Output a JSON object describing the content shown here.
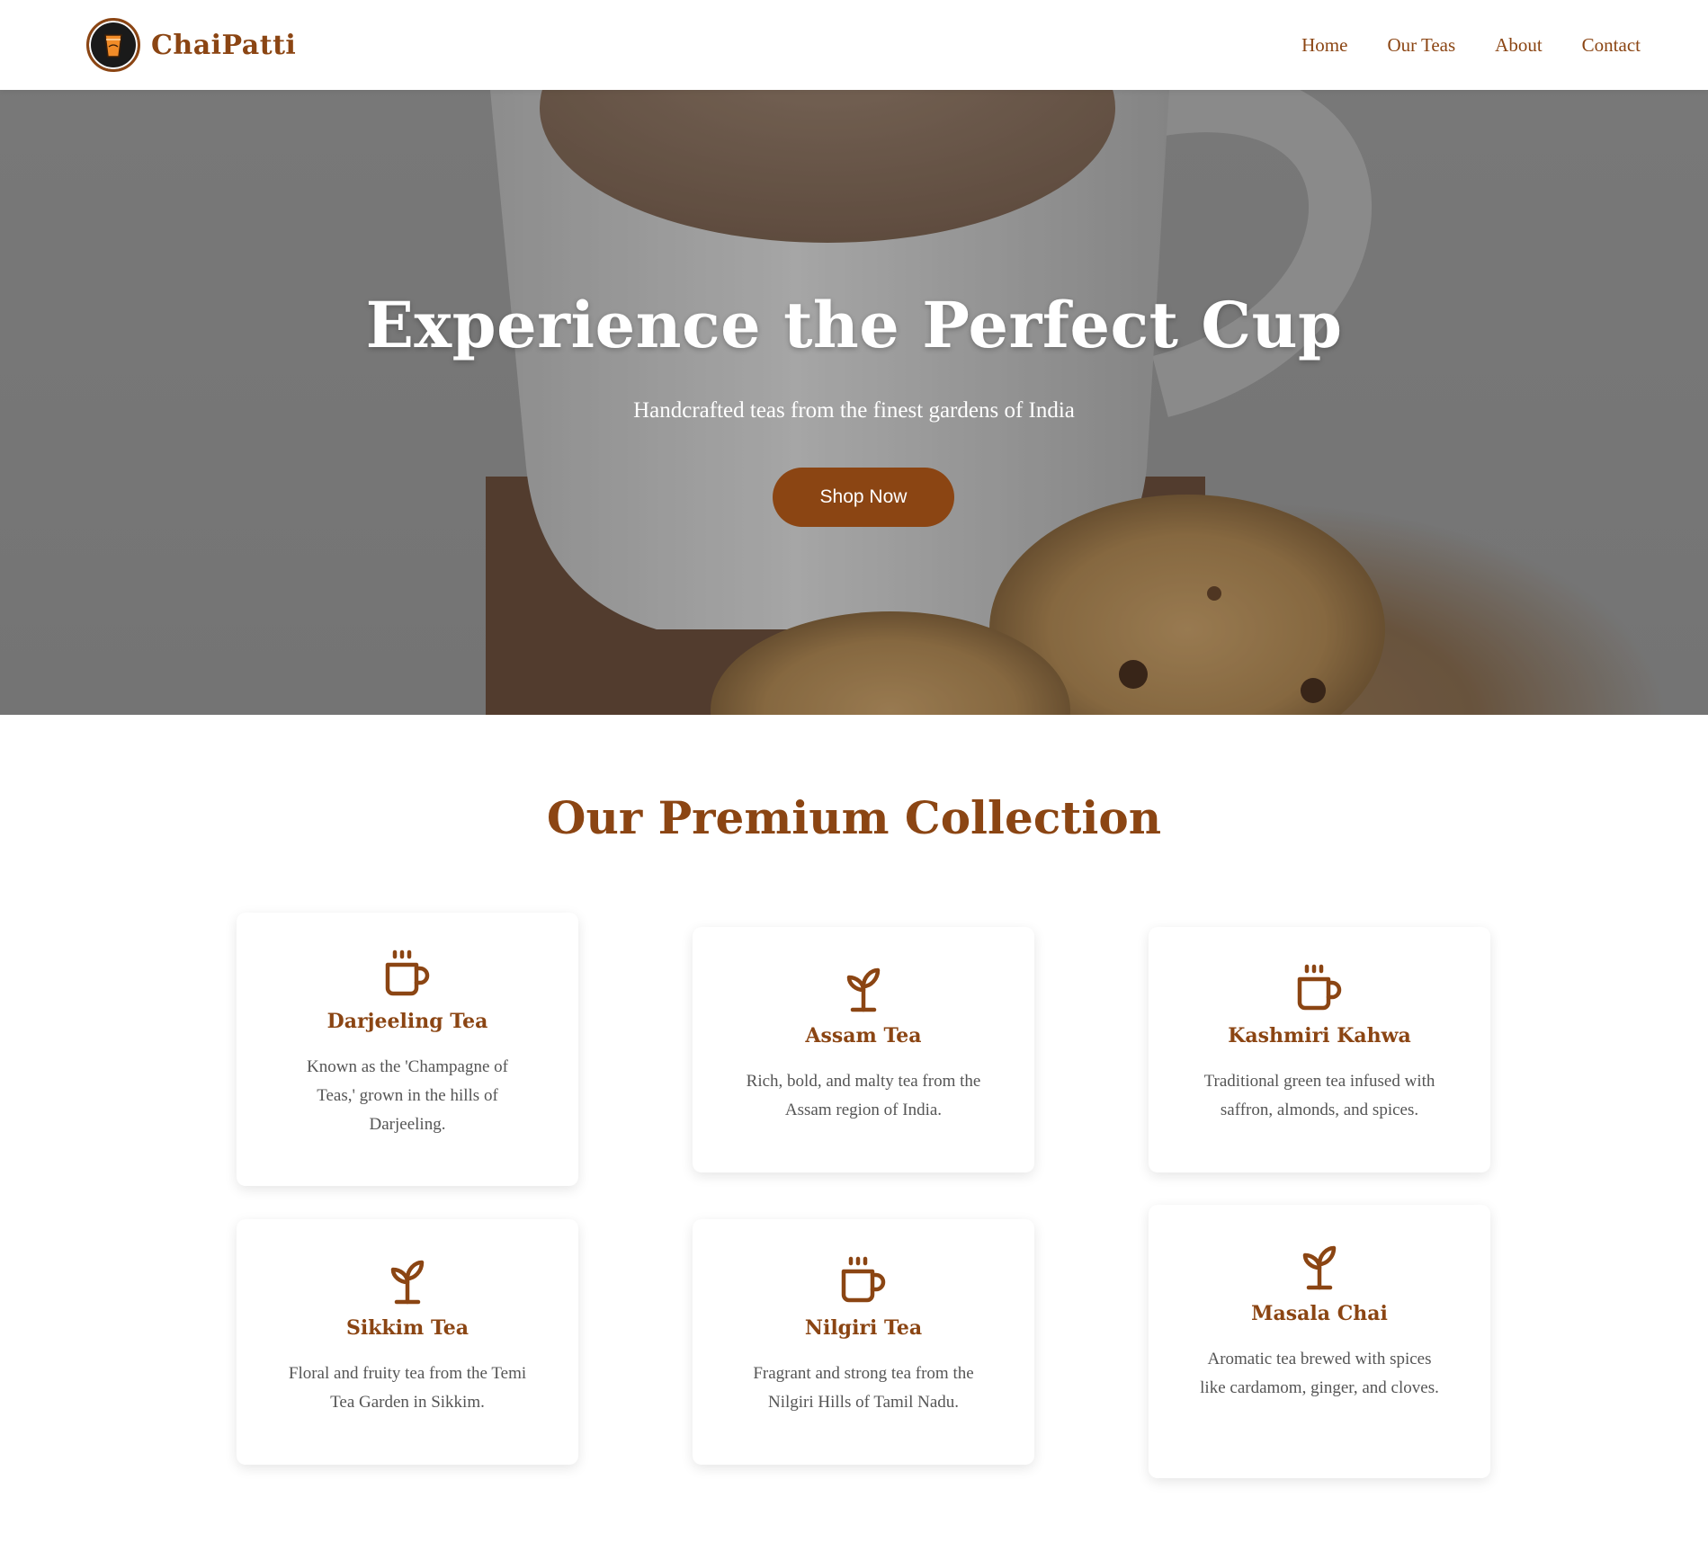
{
  "brand": {
    "name": "ChaiPatti",
    "accent": "#8b4513"
  },
  "nav": {
    "links": [
      {
        "label": "Home"
      },
      {
        "label": "Our Teas"
      },
      {
        "label": "About"
      },
      {
        "label": "Contact"
      }
    ]
  },
  "hero": {
    "title": "Experience the Perfect Cup",
    "subtitle": "Handcrafted teas from the finest gardens of India",
    "cta_label": "Shop Now"
  },
  "collection": {
    "title": "Our Premium Collection",
    "cards": [
      {
        "icon": "coffee-cup-icon",
        "title": "Darjeeling Tea",
        "description": "Known as the 'Champagne of Teas,' grown in the hills of Darjeeling."
      },
      {
        "icon": "sprout-icon",
        "title": "Assam Tea",
        "description": "Rich, bold, and malty tea from the Assam region of India."
      },
      {
        "icon": "coffee-cup-icon",
        "title": "Kashmiri Kahwa",
        "description": "Traditional green tea infused with saffron, almonds, and spices."
      },
      {
        "icon": "sprout-icon",
        "title": "Sikkim Tea",
        "description": "Floral and fruity tea from the Temi Tea Garden in Sikkim."
      },
      {
        "icon": "coffee-cup-icon",
        "title": "Nilgiri Tea",
        "description": "Fragrant and strong tea from the Nilgiri Hills of Tamil Nadu."
      },
      {
        "icon": "sprout-icon",
        "title": "Masala Chai",
        "description": "Aromatic tea brewed with spices like cardamom, ginger, and cloves."
      }
    ]
  }
}
